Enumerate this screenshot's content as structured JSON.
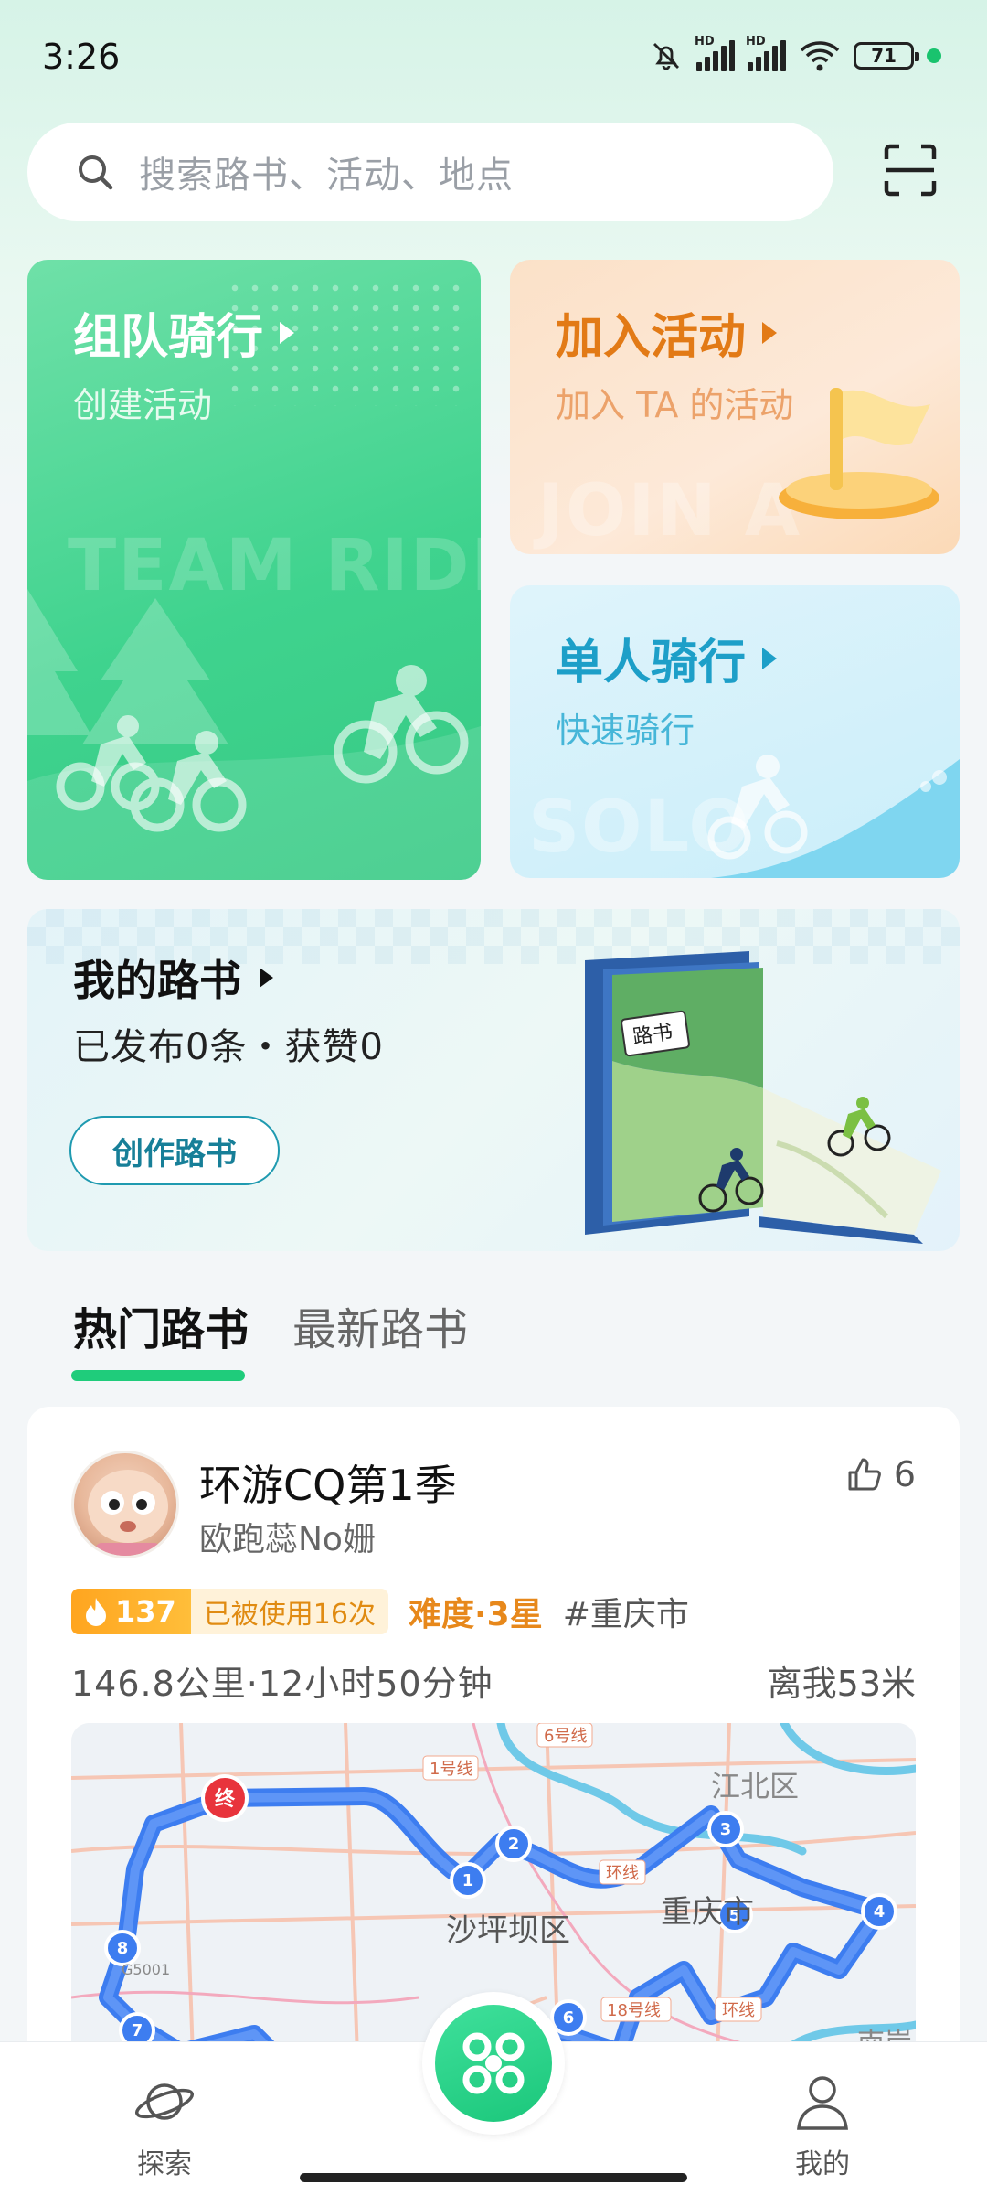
{
  "status_bar": {
    "time": "3:26",
    "battery": "71",
    "hd": "HD"
  },
  "search": {
    "placeholder": "搜索路书、活动、地点"
  },
  "cards": {
    "team": {
      "title": "组队骑行",
      "subtitle": "创建活动",
      "watermark": "TEAM RIDE"
    },
    "join": {
      "title": "加入活动",
      "subtitle": "加入 TA 的活动",
      "watermark": "JOIN A"
    },
    "solo": {
      "title": "单人骑行",
      "subtitle": "快速骑行",
      "watermark": "SOLO"
    }
  },
  "my_routes": {
    "title": "我的路书",
    "stats": "已发布0条・获赞0",
    "create_button": "创作路书",
    "book_label": "路书"
  },
  "tabs": [
    {
      "label": "热门路书",
      "active": true
    },
    {
      "label": "最新路书",
      "active": false
    }
  ],
  "route_card": {
    "name": "环游CQ第1季",
    "author": "欧跑蕊No姗",
    "likes": "6",
    "hot_count": "137",
    "used": "已被使用16次",
    "difficulty": "难度·3星",
    "city_tag": "#重庆市",
    "meta": "146.8公里·12小时50分钟",
    "distance": "离我53米",
    "map_labels": {
      "district1": "沙坪坝区",
      "district2": "重庆市",
      "district3": "江北区",
      "district4": "南岸",
      "line1": "1号线",
      "line6": "6号线",
      "line18": "18号线",
      "ring": "环线",
      "g5001": "G5001",
      "end": "终"
    },
    "waypoints": [
      "1",
      "2",
      "3",
      "4",
      "5",
      "6",
      "7",
      "8"
    ]
  },
  "bottom_nav": {
    "explore": "探索",
    "mine": "我的"
  },
  "colors": {
    "accent_green": "#1fcc7b",
    "orange": "#e27a16",
    "cyan": "#1d9fc8",
    "route_blue": "#3d7df0"
  }
}
